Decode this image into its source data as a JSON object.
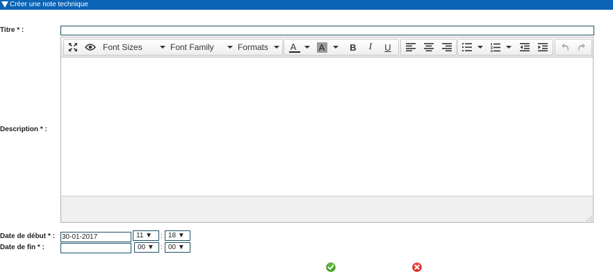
{
  "header": {
    "title": "Créer une note technique"
  },
  "form": {
    "titre_label": "Titre * :",
    "titre_value": "",
    "description_label": "Description * :",
    "start_label": "Date de début * :",
    "end_label": "Date de fin * :",
    "start_date": "30-01-2017",
    "start_hour": "11 ▼",
    "start_minute": "18 ▼",
    "end_date": "",
    "end_hour": "00 ▼",
    "end_minute": "00 ▼",
    "time_separator": ":"
  },
  "editor": {
    "font_sizes": "Font Sizes",
    "font_family": "Font Family",
    "formats": "Formats",
    "text_color_glyph": "A",
    "bg_color_glyph": "A",
    "bold_glyph": "B",
    "italic_glyph": "I",
    "underline_glyph": "U",
    "content": ""
  },
  "actions": {
    "confirm_icon": "check-icon",
    "cancel_icon": "cancel-icon",
    "confirm_color": "#44a323",
    "cancel_color": "#d8312b"
  }
}
